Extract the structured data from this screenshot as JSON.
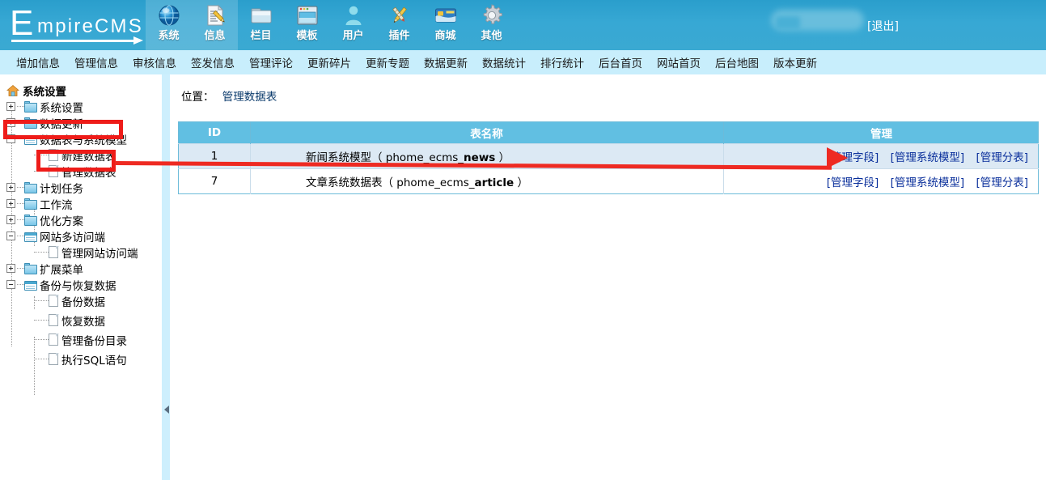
{
  "header": {
    "logo_e": "E",
    "logo_rest": "mpireCMS",
    "logout_label": "[退出]",
    "nav": [
      {
        "label": "系统",
        "icon": "globe-icon",
        "highlighted": true
      },
      {
        "label": "信息",
        "icon": "document-pencil-icon",
        "highlighted": true
      },
      {
        "label": "栏目",
        "icon": "folder-icon",
        "highlighted": false
      },
      {
        "label": "模板",
        "icon": "window-template-icon",
        "highlighted": false
      },
      {
        "label": "用户",
        "icon": "user-icon",
        "highlighted": false
      },
      {
        "label": "插件",
        "icon": "plugin-tools-icon",
        "highlighted": false
      },
      {
        "label": "商城",
        "icon": "credit-card-icon",
        "highlighted": false
      },
      {
        "label": "其他",
        "icon": "gear-icon",
        "highlighted": false
      }
    ]
  },
  "subnav": {
    "items": [
      "增加信息",
      "管理信息",
      "审核信息",
      "签发信息",
      "管理评论",
      "更新碎片",
      "更新专题",
      "数据更新",
      "数据统计",
      "排行统计",
      "后台首页",
      "网站首页",
      "后台地图",
      "版本更新"
    ]
  },
  "sidebar": {
    "root_label": "系统设置",
    "root_icon": "home-icon",
    "nodes": [
      {
        "label": "系统设置",
        "icon": "folder-icon",
        "state": "plus",
        "indent": 0
      },
      {
        "label": "数据更新",
        "icon": "folder-icon",
        "state": "plus",
        "indent": 0
      },
      {
        "label": "数据表与系统模型",
        "icon": "window-icon",
        "state": "minus",
        "indent": 0
      },
      {
        "label": "新建数据表",
        "icon": "file-icon",
        "state": "leaf",
        "indent": 1
      },
      {
        "label": "管理数据表",
        "icon": "file-icon",
        "state": "leaf",
        "indent": 1
      },
      {
        "label": "计划任务",
        "icon": "folder-icon",
        "state": "plus",
        "indent": 0
      },
      {
        "label": "工作流",
        "icon": "folder-icon",
        "state": "plus",
        "indent": 0
      },
      {
        "label": "优化方案",
        "icon": "folder-icon",
        "state": "plus",
        "indent": 0
      },
      {
        "label": "网站多访问端",
        "icon": "window-icon",
        "state": "minus",
        "indent": 0
      },
      {
        "label": "管理网站访问端",
        "icon": "file-icon",
        "state": "leaf",
        "indent": 1
      },
      {
        "label": "扩展菜单",
        "icon": "folder-icon",
        "state": "plus",
        "indent": 0
      },
      {
        "label": "备份与恢复数据",
        "icon": "window-icon",
        "state": "minus",
        "indent": 0
      },
      {
        "label": "备份数据",
        "icon": "file-icon",
        "state": "leaf",
        "indent": 1
      },
      {
        "label": "恢复数据",
        "icon": "file-icon",
        "state": "leaf",
        "indent": 1
      },
      {
        "label": "管理备份目录",
        "icon": "file-icon",
        "state": "leaf",
        "indent": 1
      },
      {
        "label": "执行SQL语句",
        "icon": "file-icon",
        "state": "leaf",
        "indent": 1
      }
    ],
    "collapse_icon": "collapse-left-arrow-icon"
  },
  "content": {
    "breadcrumb_label": "位置：",
    "breadcrumb_current": "管理数据表",
    "table": {
      "columns": [
        "ID",
        "表名称",
        "管理"
      ],
      "rows": [
        {
          "id": "1",
          "name_prefix": "新闻系统模型",
          "name_code_plain": "（ phome_ecms_",
          "name_code_bold": "news",
          "name_code_suffix": " ）",
          "actions": [
            "[管理字段]",
            "[管理系统模型]",
            "[管理分表]"
          ]
        },
        {
          "id": "7",
          "name_prefix": "文章系统数据表",
          "name_code_plain": "（ phome_ecms_",
          "name_code_bold": "article",
          "name_code_suffix": " ）",
          "actions": [
            "[管理字段]",
            "[管理系统模型]",
            "[管理分表]"
          ]
        }
      ]
    }
  },
  "annotations": {
    "highlight_color": "#ee1c19",
    "arrow_color": "#ee2a22",
    "boxes": [
      {
        "name": "highlight-datatable-model-node"
      },
      {
        "name": "highlight-manage-datatable-node"
      }
    ],
    "arrow": {
      "name": "pointer-arrow-to-manage-field-link"
    }
  }
}
